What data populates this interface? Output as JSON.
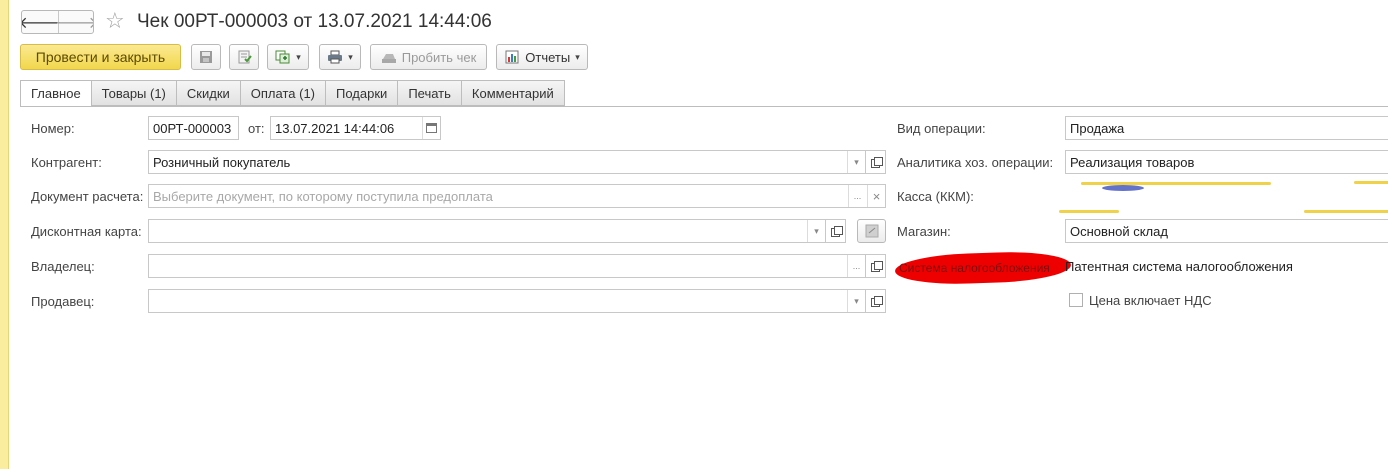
{
  "window": {
    "title": "Чек 00РТ-000003 от 13.07.2021 14:44:06",
    "back_glyph": "🡐",
    "forward_glyph": "🡒",
    "favorite_glyph": "☆"
  },
  "toolbar": {
    "post_and_close": "Провести и закрыть",
    "print_receipt": "Пробить чек",
    "reports": "Отчеты",
    "dropdown_glyph": "▾"
  },
  "tabs": [
    "Главное",
    "Товары (1)",
    "Скидки",
    "Оплата (1)",
    "Подарки",
    "Печать",
    "Комментарий"
  ],
  "form": {
    "number_label": "Номер:",
    "number_value": "00РТ-000003",
    "date_label": "от:",
    "date_value": "13.07.2021 14:44:06",
    "counterparty_label": "Контрагент:",
    "counterparty_value": "Розничный покупатель",
    "settlement_doc_label": "Документ расчета:",
    "settlement_doc_placeholder": "Выберите документ, по которому поступила предоплата",
    "discount_card_label": "Дисконтная карта:",
    "owner_label": "Владелец:",
    "seller_label": "Продавец:",
    "operation_label": "Вид операции:",
    "operation_value": "Продажа",
    "analytics_label": "Аналитика хоз. операции:",
    "analytics_value": "Реализация товаров",
    "cash_register_label": "Касса (ККМ):",
    "store_label": "Магазин:",
    "store_value": "Основной склад",
    "tax_system_label": "Система налогообложения",
    "tax_system_value": "Патентная система налогообложения",
    "vat_included_label": "Цена включает НДС",
    "vat_included": false,
    "ellipsis": "...",
    "clear_glyph": "×",
    "dropdown_glyph": "▾"
  },
  "colors": {
    "primary_button": "#f2d74c",
    "redaction_red": "#ee0000",
    "left_strip": "#fbed9e"
  }
}
